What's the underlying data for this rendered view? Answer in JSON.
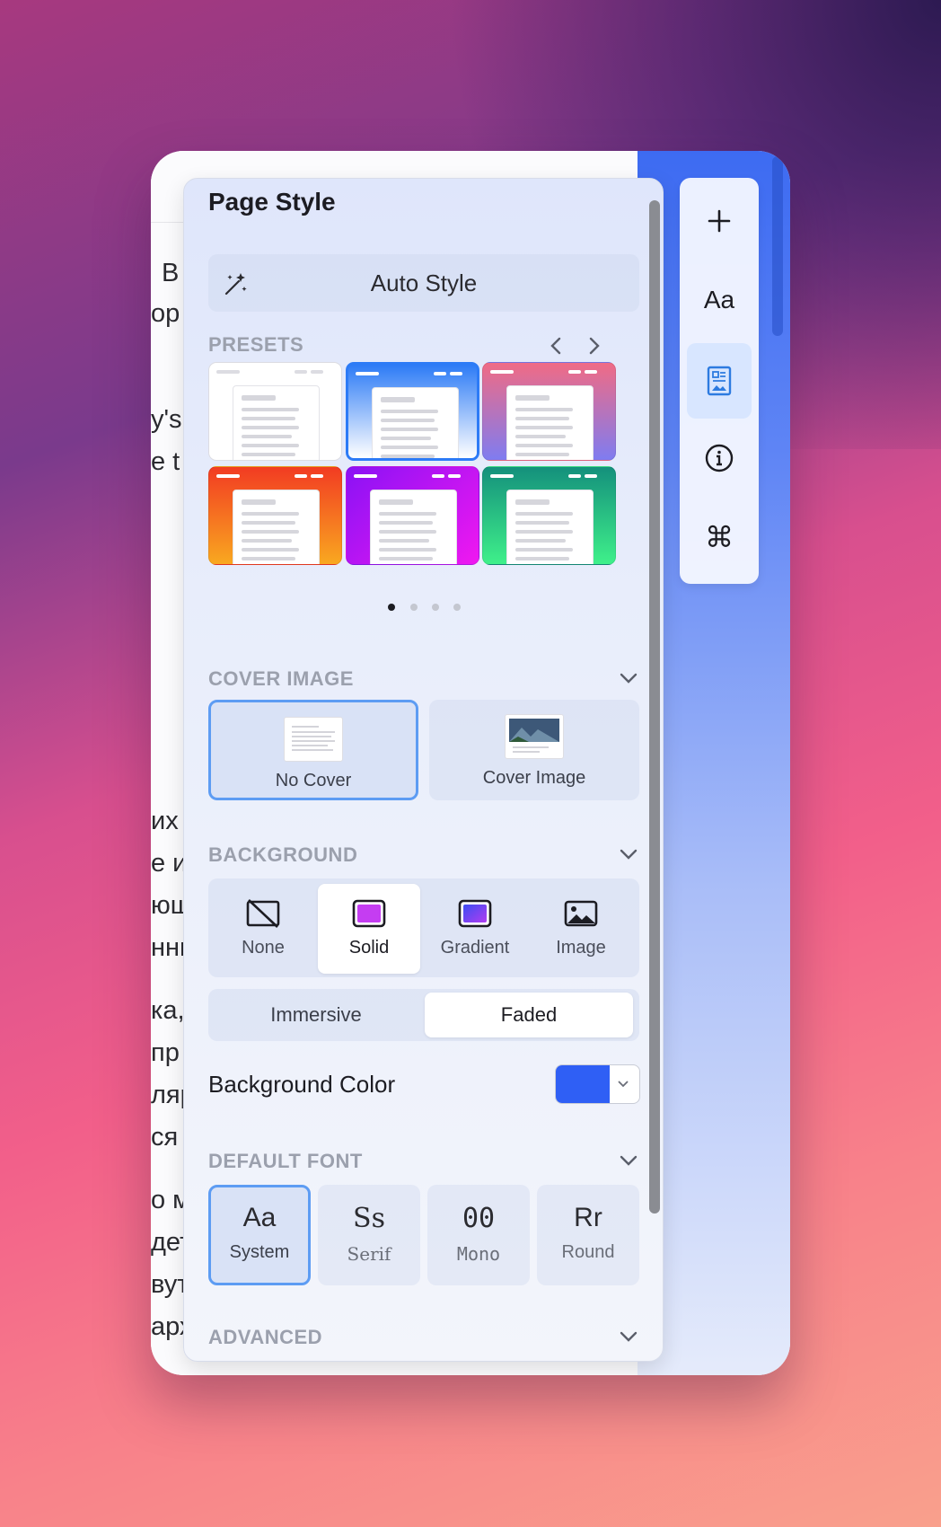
{
  "document": {
    "lines": [
      "В",
      "ор",
      "y's",
      "e t",
      "их д",
      "е и",
      "юще",
      "нны",
      "ка,",
      "пр",
      "ляр",
      "ся л",
      "о м",
      "дет",
      "вут",
      "арх"
    ]
  },
  "toolbar": {
    "items": [
      {
        "name": "add-icon",
        "glyph": "+"
      },
      {
        "name": "typography-icon",
        "glyph": "Aa"
      },
      {
        "name": "page-style-icon",
        "glyph": "▣"
      },
      {
        "name": "info-icon",
        "glyph": "ⓘ"
      },
      {
        "name": "command-icon",
        "glyph": "⌘"
      }
    ]
  },
  "panel": {
    "title": "Page Style",
    "auto_style": "Auto Style",
    "presets": {
      "label": "PRESETS",
      "items": [
        {
          "name": "white",
          "bg": "#ffffff"
        },
        {
          "name": "blue",
          "bg": "linear-gradient(180deg,#2d7bf6,#ffffff)"
        },
        {
          "name": "pink",
          "bg": "linear-gradient(180deg,#f06b85,#7f7cf0)"
        },
        {
          "name": "orange",
          "bg": "linear-gradient(180deg,#f23b22,#f9a820)"
        },
        {
          "name": "purple",
          "bg": "linear-gradient(135deg,#8a12f5,#f018f0)"
        },
        {
          "name": "green",
          "bg": "linear-gradient(180deg,#14907c,#3ff08a)"
        }
      ],
      "page_count": 4,
      "current_page": 1
    },
    "cover": {
      "label": "COVER IMAGE",
      "options": [
        {
          "label": "No Cover",
          "selected": true
        },
        {
          "label": "Cover Image",
          "selected": false
        }
      ]
    },
    "background": {
      "label": "BACKGROUND",
      "types": [
        {
          "label": "None",
          "icon": "no-image-icon",
          "selected": false
        },
        {
          "label": "Solid",
          "icon": "solid-color-icon",
          "selected": true
        },
        {
          "label": "Gradient",
          "icon": "gradient-icon",
          "selected": false
        },
        {
          "label": "Image",
          "icon": "image-icon",
          "selected": false
        }
      ],
      "modes": [
        {
          "label": "Immersive",
          "selected": false
        },
        {
          "label": "Faded",
          "selected": true
        }
      ],
      "color_label": "Background Color",
      "color": "#2f5ff5"
    },
    "font": {
      "label": "DEFAULT FONT",
      "options": [
        {
          "sample": "Aa",
          "label": "System",
          "selected": true
        },
        {
          "sample": "Ss",
          "label": "Serif",
          "selected": false
        },
        {
          "sample": "00",
          "label": "Mono",
          "selected": false
        },
        {
          "sample": "Rr",
          "label": "Round",
          "selected": false
        }
      ]
    },
    "advanced": {
      "label": "ADVANCED"
    }
  }
}
